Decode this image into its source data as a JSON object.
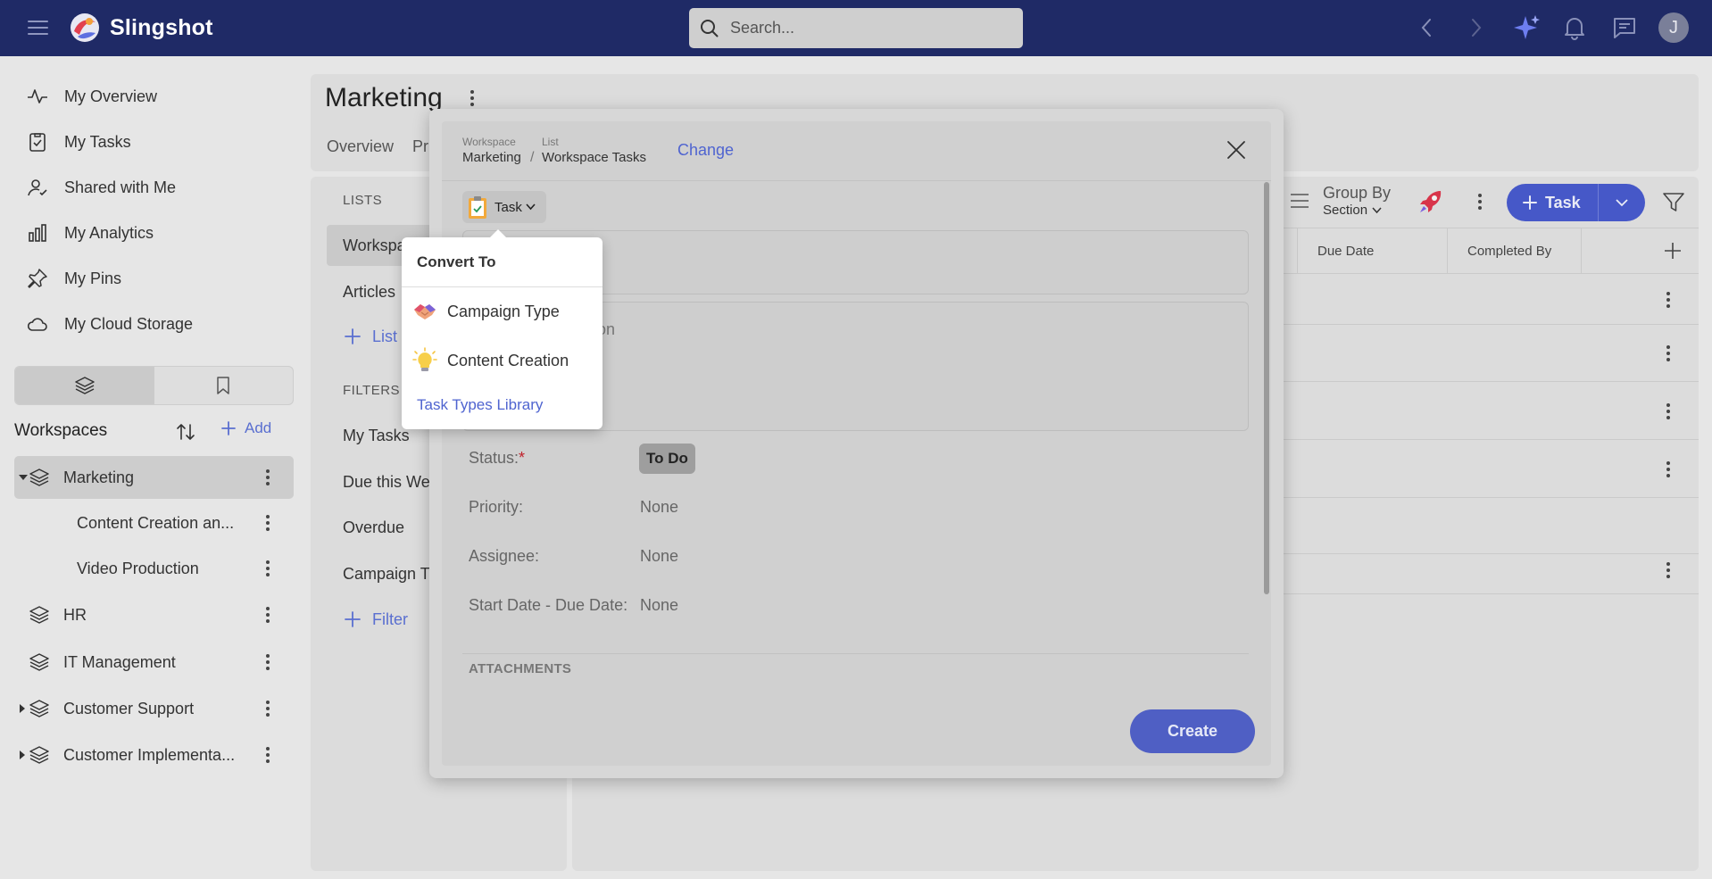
{
  "app": {
    "brand": "Slingshot"
  },
  "search": {
    "placeholder": "Search..."
  },
  "user": {
    "initial": "J"
  },
  "sidebar": {
    "nav": [
      {
        "label": "My Overview",
        "icon": "pulse-icon"
      },
      {
        "label": "My Tasks",
        "icon": "clipboard-check-icon"
      },
      {
        "label": "Shared with Me",
        "icon": "user-check-icon"
      },
      {
        "label": "My Analytics",
        "icon": "bar-chart-icon"
      },
      {
        "label": "My Pins",
        "icon": "pin-icon"
      },
      {
        "label": "My Cloud Storage",
        "icon": "cloud-icon"
      }
    ],
    "workspaces_title": "Workspaces",
    "add_label": "Add",
    "workspaces": [
      {
        "label": "Marketing"
      },
      {
        "label": "Content Creation an..."
      },
      {
        "label": "Video Production"
      },
      {
        "label": "HR"
      },
      {
        "label": "IT Management"
      },
      {
        "label": "Customer Support"
      },
      {
        "label": "Customer Implementa..."
      }
    ]
  },
  "page": {
    "title": "Marketing",
    "tabs": [
      "Overview",
      "Pr"
    ]
  },
  "lists_panel": {
    "lists_title": "LISTS",
    "lists": [
      "Workspa",
      "Articles"
    ],
    "add_list": "List",
    "filters_title": "FILTERS",
    "filters": [
      "My Tasks",
      "Due this Wee",
      "Overdue",
      "Campaign Ty"
    ],
    "add_filter": "Filter"
  },
  "toolbar": {
    "group_by_title": "Group By",
    "group_by_value": "Section",
    "task_button": "Task"
  },
  "table": {
    "columns": [
      "Due Date",
      "Completed By"
    ]
  },
  "modal": {
    "crumb_workspace_key": "Workspace",
    "crumb_workspace_value": "Marketing",
    "crumb_sep": "/",
    "crumb_list_key": "List",
    "crumb_list_value": "Workspace Tasks",
    "change_link": "Change",
    "type_chip": "Task",
    "description_placeholder": "on",
    "props": {
      "status_label": "Status:",
      "status_required": "*",
      "status_value": "To Do",
      "priority_label": "Priority:",
      "priority_value": "None",
      "assignee_label": "Assignee:",
      "assignee_value": "None",
      "dates_label": "Start Date - Due Date:",
      "dates_value": "None"
    },
    "attachments_title": "ATTACHMENTS",
    "create_button": "Create"
  },
  "popover": {
    "title": "Convert To",
    "items": [
      {
        "label": "Campaign Type",
        "icon": "handshake-icon"
      },
      {
        "label": "Content Creation",
        "icon": "lightbulb-icon"
      }
    ],
    "library_link": "Task Types Library"
  },
  "colors": {
    "topbar": "#1f2a66",
    "accent": "#4f64d0",
    "primary_button": "#4658c8"
  }
}
